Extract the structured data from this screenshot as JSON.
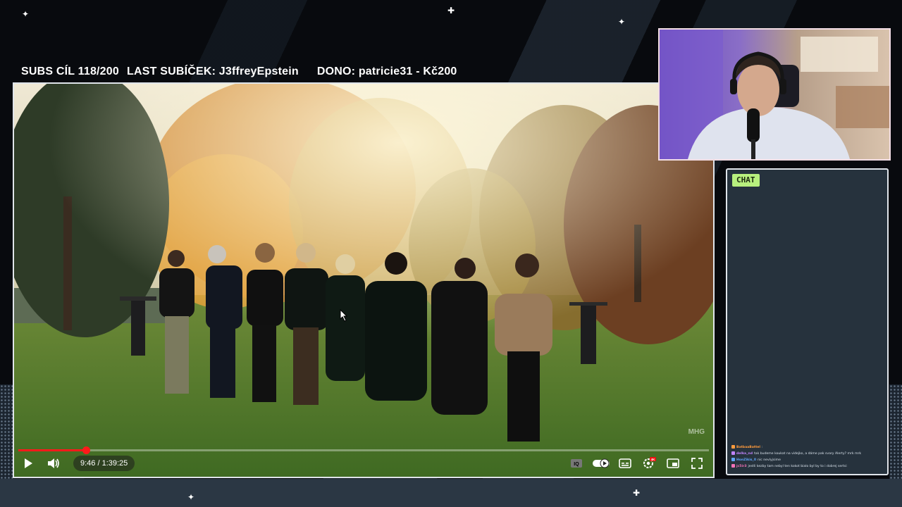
{
  "overlay": {
    "subs_goal": "SUBS CÍL 118/200",
    "last_sub": "LAST SUBÍČEK: J3ffreyEpstein",
    "donation": "DONO: patricie31 - Kč200"
  },
  "player": {
    "watermark": "MHG",
    "time_display": "9:46 / 1:39:25",
    "progress_fraction": 0.098,
    "settings_badge": "4K",
    "icons": [
      "play-icon",
      "volume-icon",
      "iq-icon",
      "autoplay-toggle-icon",
      "subtitles-icon",
      "settings-icon",
      "miniplayer-icon",
      "fullscreen-icon"
    ]
  },
  "chat": {
    "title": "CHAT",
    "messages": [
      {
        "user": "BatbaaBattel",
        "text": ":",
        "color": "#ff9b3d"
      },
      {
        "user": "delka_nd",
        "text": "tak budeme koukat na videjko, a dáme pak svary Alerty? mrk mrk",
        "color": "#c084fc"
      },
      {
        "user": "HonZikis_0",
        "text": "nic nevlyjsime",
        "color": "#60a5fa"
      },
      {
        "user": "jc5ir3",
        "text": "jestli kezby tam nebyl ten kokot bialo byl by to i dobrej sertsi",
        "color": "#f472b6"
      }
    ]
  },
  "colors": {
    "chat_title_bg": "#b8f07e",
    "progress": "#ff1a1a",
    "panel_bg": "#26323d"
  }
}
